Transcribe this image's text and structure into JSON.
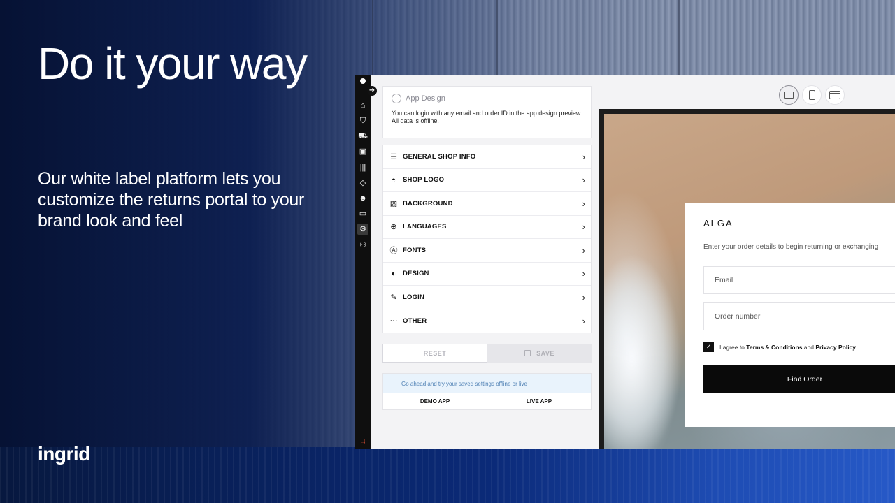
{
  "hero": {
    "title": "Do it your way",
    "subtitle": "Our white label platform lets you customize the returns portal to your brand look and feel",
    "logo_text": "ingrid"
  },
  "sidebar_rail": {
    "icons": [
      "home-icon",
      "shirt-icon",
      "truck-icon",
      "package-icon",
      "barcode-icon",
      "tag-icon",
      "users-icon",
      "card-icon",
      "gear-icon",
      "sitemap-icon"
    ],
    "active": "gear-icon",
    "bottom_icon": "logout-icon"
  },
  "design_panel": {
    "title": "App Design",
    "info": "You can login with any email and order ID in the app design preview. All data is offline.",
    "menu": [
      {
        "label": "GENERAL SHOP INFO",
        "icon": "database-icon"
      },
      {
        "label": "SHOP LOGO",
        "icon": "image-icon"
      },
      {
        "label": "BACKGROUND",
        "icon": "picture-icon"
      },
      {
        "label": "LANGUAGES",
        "icon": "globe-icon"
      },
      {
        "label": "FONTS",
        "icon": "font-icon"
      },
      {
        "label": "DESIGN",
        "icon": "palette-icon"
      },
      {
        "label": "LOGIN",
        "icon": "edit-icon"
      },
      {
        "label": "OTHER",
        "icon": "more-icon"
      }
    ],
    "reset_label": "RESET",
    "save_label": "SAVE",
    "try_message": "Go ahead and try your saved settings offline or live",
    "demo_label": "DEMO APP",
    "live_label": "LIVE APP"
  },
  "device_switcher": {
    "options": [
      "desktop-icon",
      "mobile-icon",
      "browser-icon"
    ],
    "active": "desktop-icon"
  },
  "preview": {
    "brand": "ALGA",
    "intro": "Enter your order details to begin returning or exchanging",
    "email_placeholder": "Email",
    "order_placeholder": "Order number",
    "terms_prefix": "I agree to",
    "terms_link": "Terms & Conditions",
    "terms_and": "and",
    "privacy_link": "Privacy Policy",
    "find_label": "Find Order"
  }
}
